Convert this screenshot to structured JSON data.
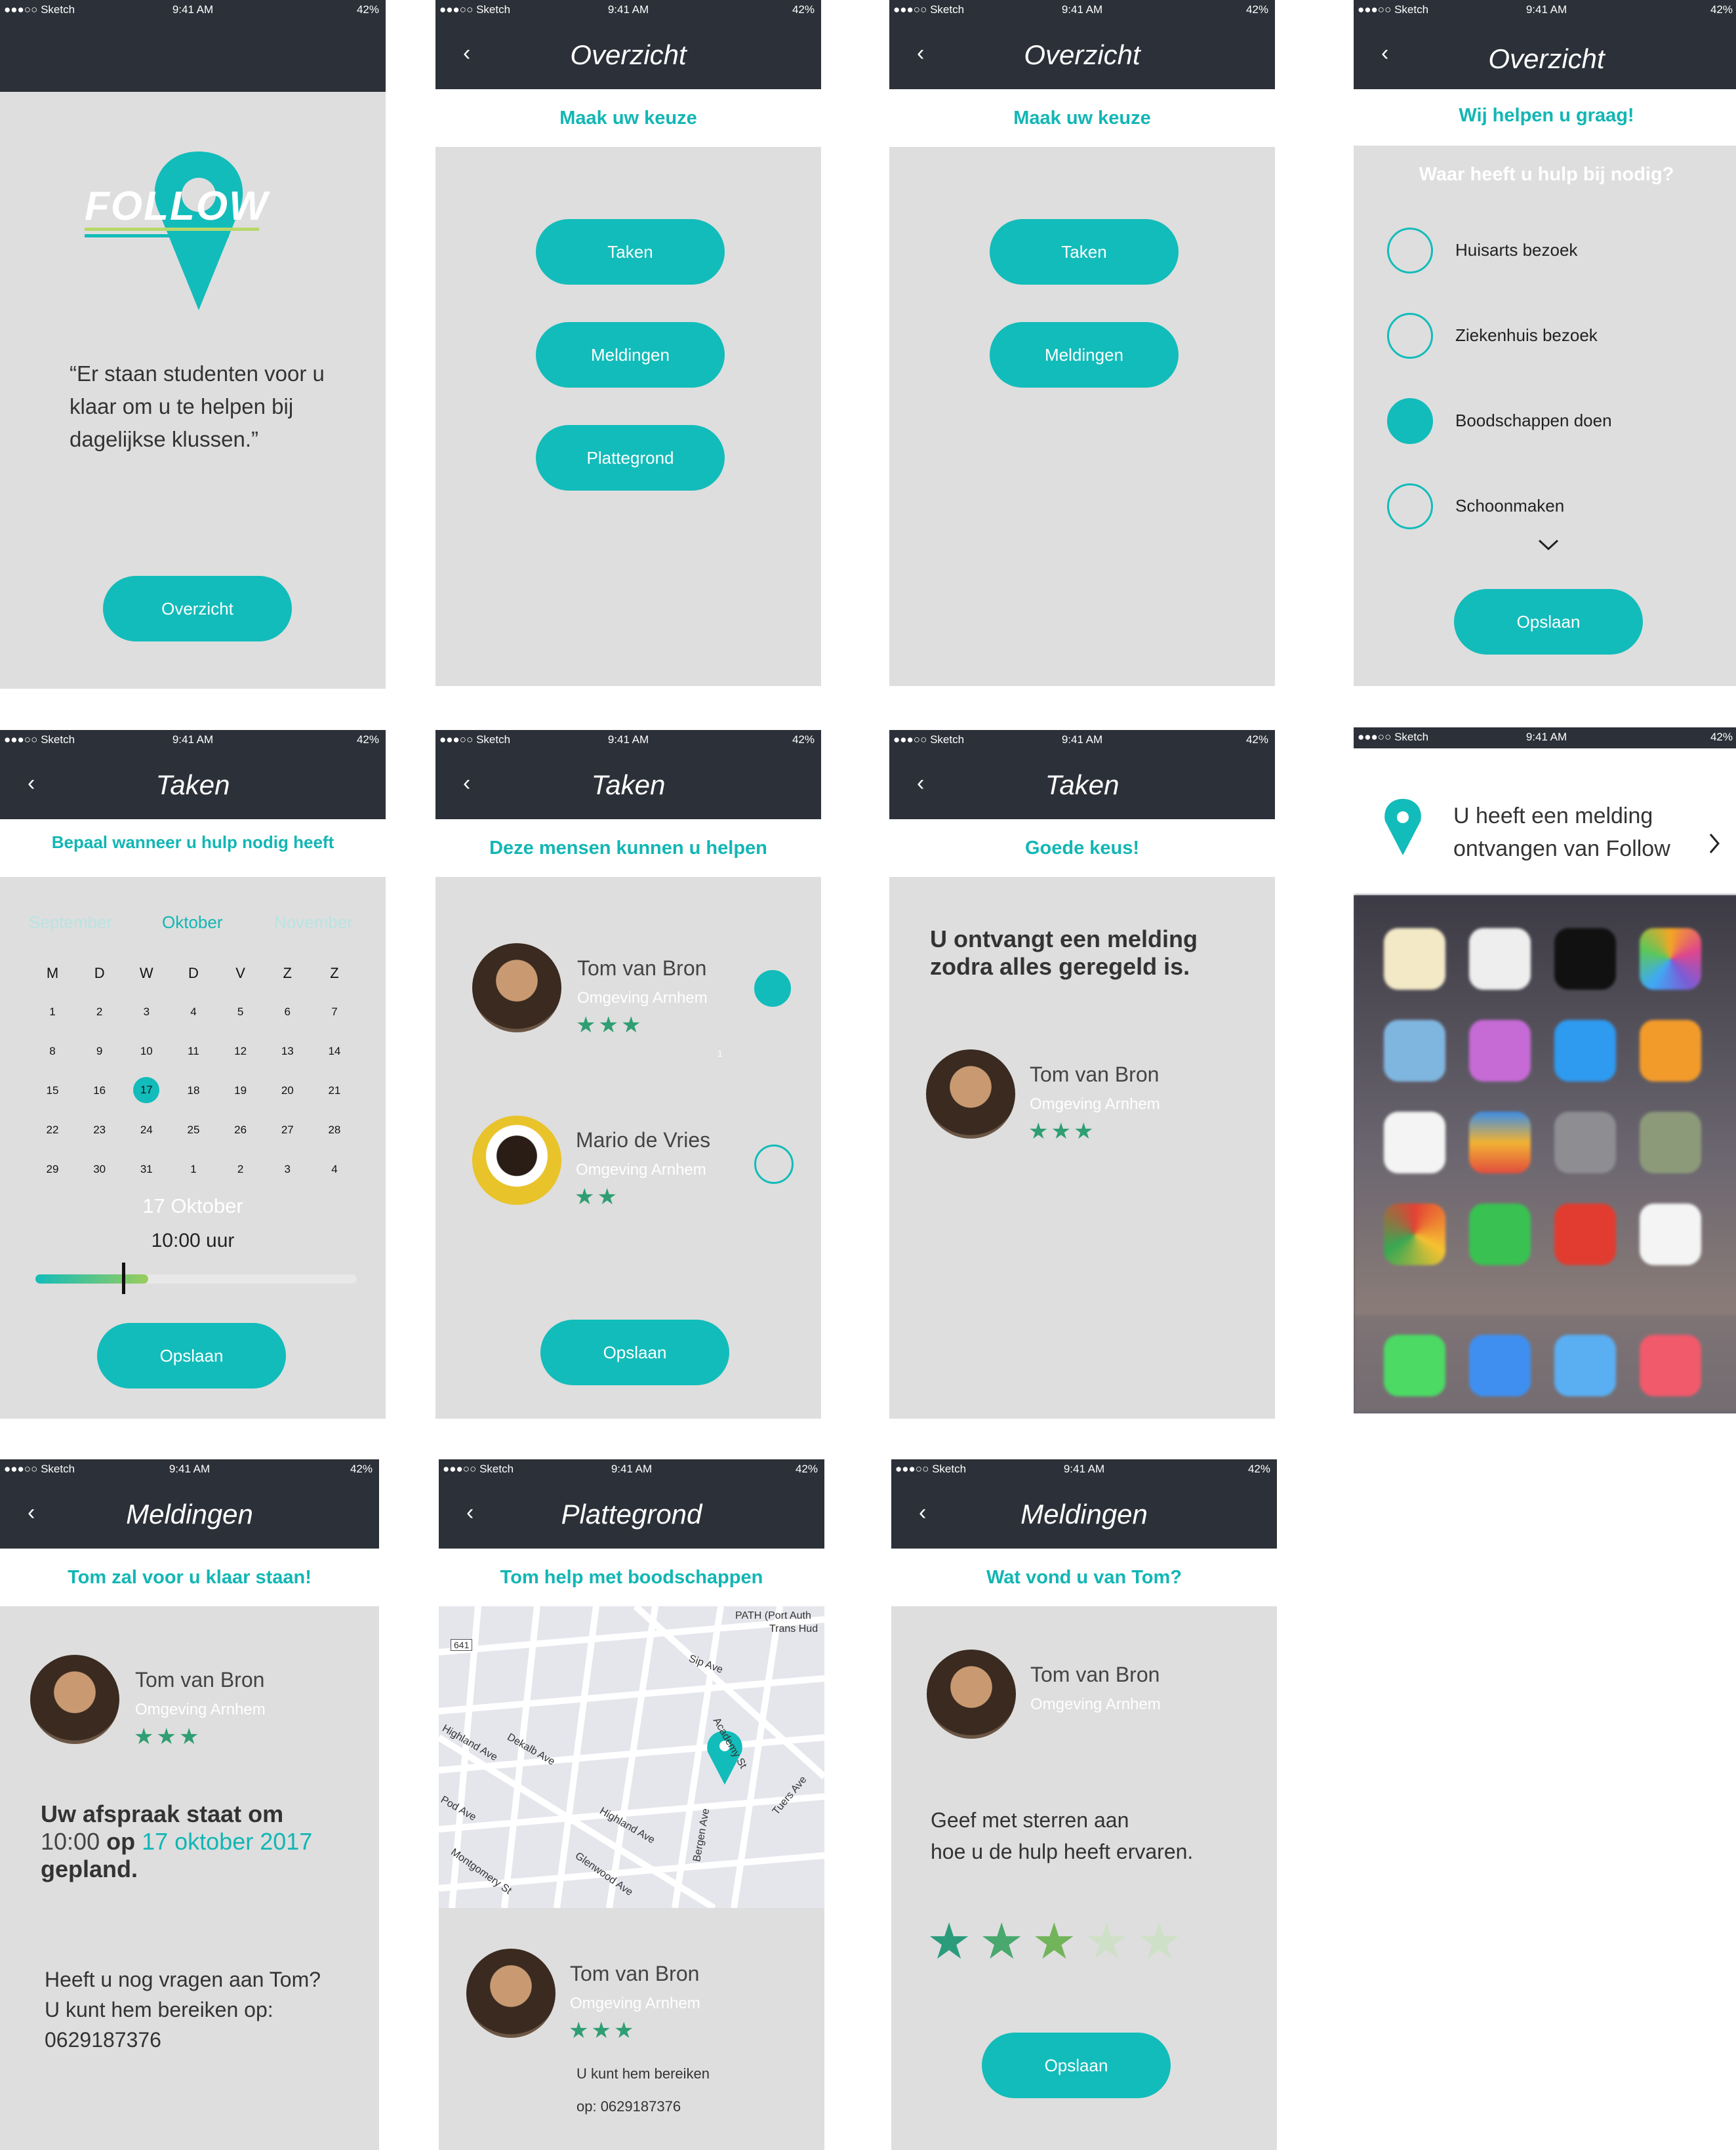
{
  "statusbar": {
    "carrier": "●●●○○ Sketch",
    "time": "9:41 AM",
    "battery": "42%"
  },
  "s1": {
    "logo_text": "FOLLOW",
    "quote": "“Er staan studenten voor u klaar om u te helpen bij dagelijkse klussen.”",
    "button": "Overzicht"
  },
  "s2": {
    "title": "Overzicht",
    "subheader": "Maak uw keuze",
    "buttons": [
      "Taken",
      "Meldingen",
      "Plattegrond"
    ]
  },
  "s3": {
    "title": "Overzicht",
    "subheader": "Maak uw keuze",
    "buttons": [
      "Taken",
      "Meldingen"
    ]
  },
  "s4": {
    "title": "Overzicht",
    "subheader": "Wij helpen u graag!",
    "question": "Waar heeft u hulp bij nodig?",
    "options": [
      "Huisarts bezoek",
      "Ziekenhuis bezoek",
      "Boodschappen doen",
      "Schoonmaken"
    ],
    "selected_option": "Boodschappen doen",
    "button": "Opslaan"
  },
  "s5": {
    "title": "Taken",
    "subheader": "Bepaal wanneer u hulp nodig heeft",
    "months": [
      "September",
      "Oktober",
      "November"
    ],
    "weekdays": [
      "M",
      "D",
      "W",
      "D",
      "V",
      "Z",
      "Z"
    ],
    "weeks": [
      [
        "1",
        "2",
        "3",
        "4",
        "5",
        "6",
        "7"
      ],
      [
        "8",
        "9",
        "10",
        "11",
        "12",
        "13",
        "14"
      ],
      [
        "15",
        "16",
        "17",
        "18",
        "19",
        "20",
        "21"
      ],
      [
        "22",
        "23",
        "24",
        "25",
        "26",
        "27",
        "28"
      ],
      [
        "29",
        "30",
        "31",
        "1",
        "2",
        "3",
        "4"
      ]
    ],
    "selected_day": "17",
    "selected_date": "17 Oktober",
    "time": "10:00 uur",
    "time_slider_value": 0.27,
    "button": "Opslaan"
  },
  "s6": {
    "title": "Taken",
    "subheader": "Deze mensen kunnen u helpen",
    "people": [
      {
        "name": "Tom van Bron",
        "location": "Omgeving Arnhem",
        "rating": 3,
        "stars": "★★★",
        "selected": true
      },
      {
        "name": "Mario de Vries",
        "location": "Omgeving Arnhem",
        "rating": 2,
        "stars": "★★",
        "selected": false
      }
    ],
    "page_marker": "1",
    "button": "Opslaan"
  },
  "s7": {
    "title": "Taken",
    "subheader": "Goede keus!",
    "message": "U ontvangt een melding zodra alles geregeld is.",
    "person": {
      "name": "Tom van Bron",
      "location": "Omgeving Arnhem",
      "rating": 3,
      "stars": "★★★"
    }
  },
  "s8": {
    "notification": "U heeft een melding ontvangen van Follow"
  },
  "s9": {
    "title": "Meldingen",
    "subheader": "Tom zal voor u klaar staan!",
    "person": {
      "name": "Tom van Bron",
      "location": "Omgeving Arnhem",
      "rating": 3,
      "stars": "★★★"
    },
    "appt_line1": "Uw afspraak staat om",
    "appt_time": "10:00",
    "appt_op": "op",
    "appt_date": "17 oktober 2017",
    "appt_line3": "gepland.",
    "contact_line1": "Heeft u nog vragen aan Tom?",
    "contact_line2": "U kunt hem bereiken op:",
    "phone": "0629187376"
  },
  "s10": {
    "title": "Plattegrond",
    "subheader": "Tom help met boodschappen",
    "map_labels": [
      "PATH (Port Auth",
      "Trans Hud",
      "641",
      "Sip Ave",
      "Highland Ave",
      "Dekalb Ave",
      "Pod Ave",
      "Highland Ave",
      "Bergen Ave",
      "Tuers Ave",
      "Glenwood Ave",
      "Montgomery St",
      "Academy St"
    ],
    "person": {
      "name": "Tom van Bron",
      "location": "Omgeving Arnhem",
      "rating": 3,
      "stars": "★★★"
    },
    "contact": "U kunt hem bereiken",
    "contact_phone": "op: 0629187376"
  },
  "s11": {
    "title": "Meldingen",
    "subheader": "Wat vond u van Tom?",
    "person": {
      "name": "Tom van Bron",
      "location": "Omgeving Arnhem"
    },
    "prompt_line1": "Geef met sterren aan",
    "prompt_line2": "hoe u de hulp heeft ervaren.",
    "rating": 3,
    "rating_max": 5,
    "button": "Opslaan"
  },
  "colors": {
    "accent": "#12bcba",
    "nav": "#2c3038",
    "screen_bg": "#dedede",
    "star": "#2f9e73"
  }
}
